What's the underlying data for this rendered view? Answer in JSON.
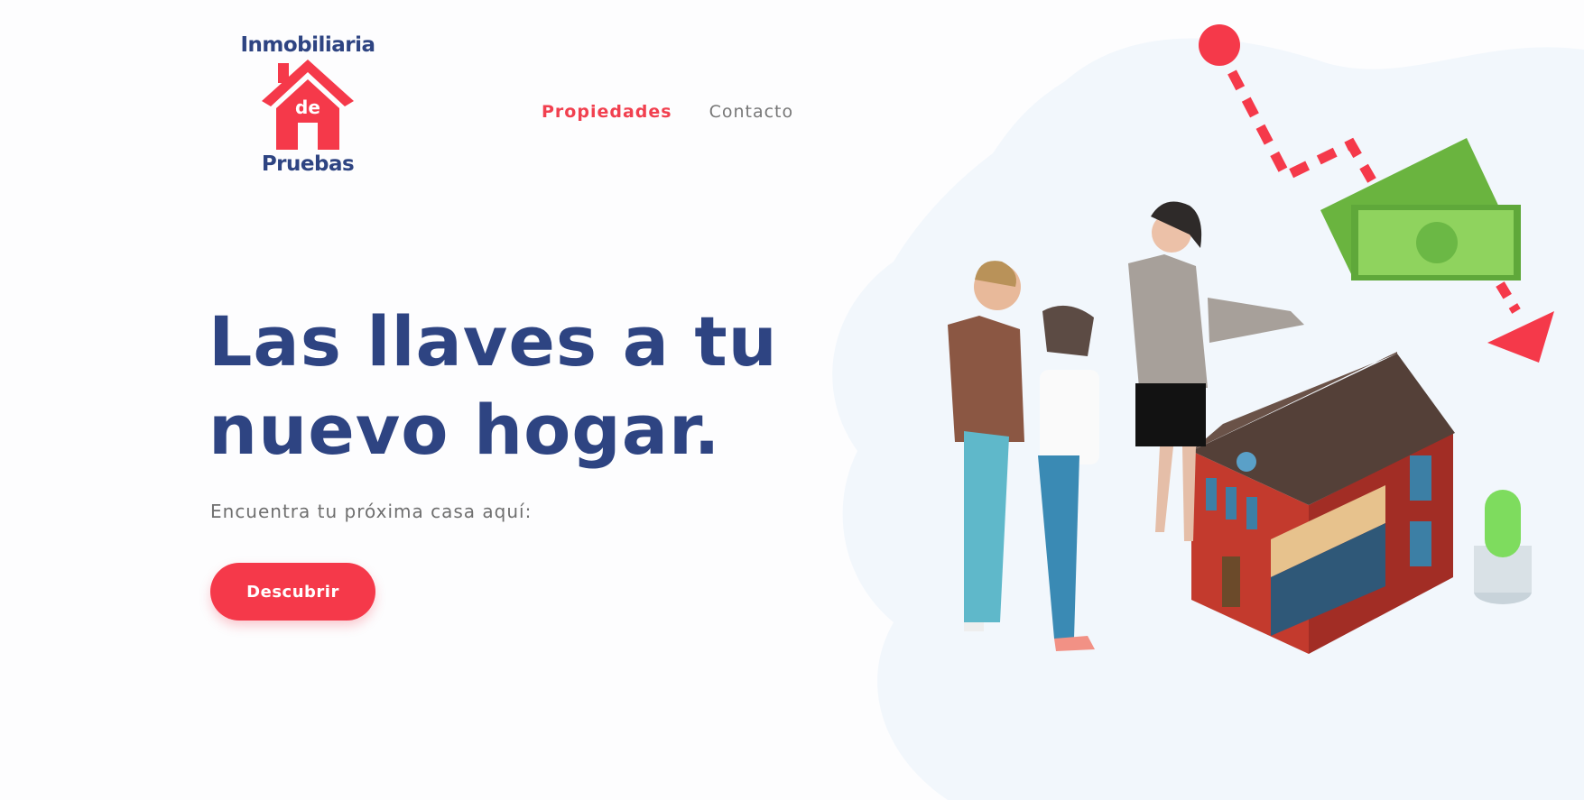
{
  "logo": {
    "top_text": "Inmobiliaria",
    "house_text": "de",
    "bottom_text": "Pruebas"
  },
  "nav": {
    "items": [
      {
        "label": "Propiedades",
        "active": true
      },
      {
        "label": "Contacto",
        "active": false
      }
    ]
  },
  "hero": {
    "title": "Las llaves a tu nuevo hogar.",
    "subtitle": "Encuentra tu próxima casa aquí:",
    "cta_label": "Descubrir"
  },
  "colors": {
    "brand_blue": "#2e4482",
    "accent_red": "#f5394a",
    "money_green": "#72c44a",
    "blob": "#f2f7fc"
  },
  "illustration": [
    "house-icon",
    "money-icon",
    "people-icon",
    "plant-icon",
    "dashed-arrow-icon"
  ]
}
